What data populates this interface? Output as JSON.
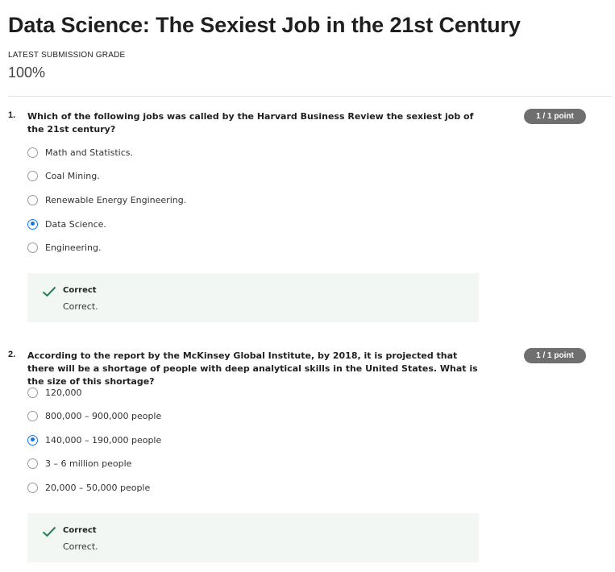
{
  "page": {
    "title": "Data Science: The Sexiest Job in the 21st Century",
    "grade_label": "LATEST SUBMISSION GRADE",
    "grade_value": "100%"
  },
  "questions": [
    {
      "number": "1.",
      "text": "Which of the following jobs was called by the Harvard Business Review the sexiest job of the 21st century?",
      "points": "1 / 1 point",
      "options": [
        {
          "label": "Math and Statistics.",
          "selected": false
        },
        {
          "label": "Coal Mining.",
          "selected": false
        },
        {
          "label": "Renewable Energy Engineering.",
          "selected": false
        },
        {
          "label": "Data Science.",
          "selected": true
        },
        {
          "label": "Engineering.",
          "selected": false
        }
      ],
      "feedback": {
        "title": "Correct",
        "text": "Correct."
      }
    },
    {
      "number": "2.",
      "text": "According to the report by the McKinsey Global Institute, by 2018, it is projected that there will be a shortage of people with deep analytical skills in the United States. What is the size of this shortage?",
      "points": "1 / 1 point",
      "options": [
        {
          "label": "120,000",
          "selected": false
        },
        {
          "label": "800,000 – 900,000 people",
          "selected": false
        },
        {
          "label": "140,000 – 190,000 people",
          "selected": true
        },
        {
          "label": "3 – 6 million people",
          "selected": false
        },
        {
          "label": "20,000 – 50,000 people",
          "selected": false
        }
      ],
      "feedback": {
        "title": "Correct",
        "text": "Correct."
      }
    }
  ],
  "colors": {
    "accent": "#1a73e8",
    "success": "#1f8354",
    "badge": "#6f6f6f",
    "feedback_bg": "#f2f7f4"
  }
}
